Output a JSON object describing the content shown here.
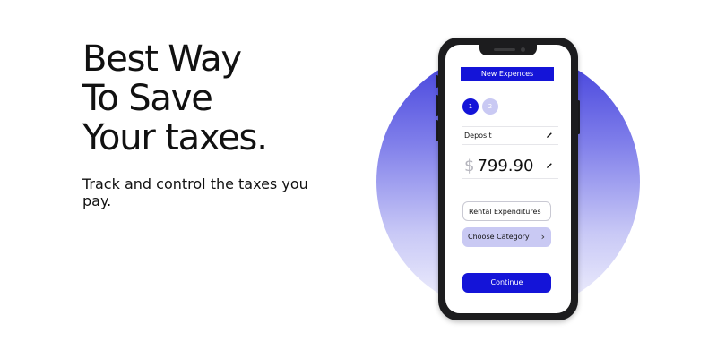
{
  "hero": {
    "title": "Best Way\nTo Save\nYour taxes.",
    "subtitle": "Track and control the taxes you pay."
  },
  "app": {
    "header_title": "New Expences",
    "steps": [
      {
        "label": "1",
        "state": "active"
      },
      {
        "label": "2",
        "state": "inactive"
      }
    ],
    "deposit_label": "Deposit",
    "currency_symbol": "$",
    "amount": "799.90",
    "rental_field": "Rental Expenditures",
    "category_select": "Choose Category",
    "continue_label": "Continue"
  },
  "icons": [
    "pencil-icon",
    "chevron-right-icon",
    "front-camera-icon",
    "speaker-icon"
  ],
  "colors": {
    "brand": "#1414d8",
    "brand_light": "#c9c9f3",
    "circle_top": "#3f3ddb",
    "phone_frame": "#1c1c1e"
  }
}
